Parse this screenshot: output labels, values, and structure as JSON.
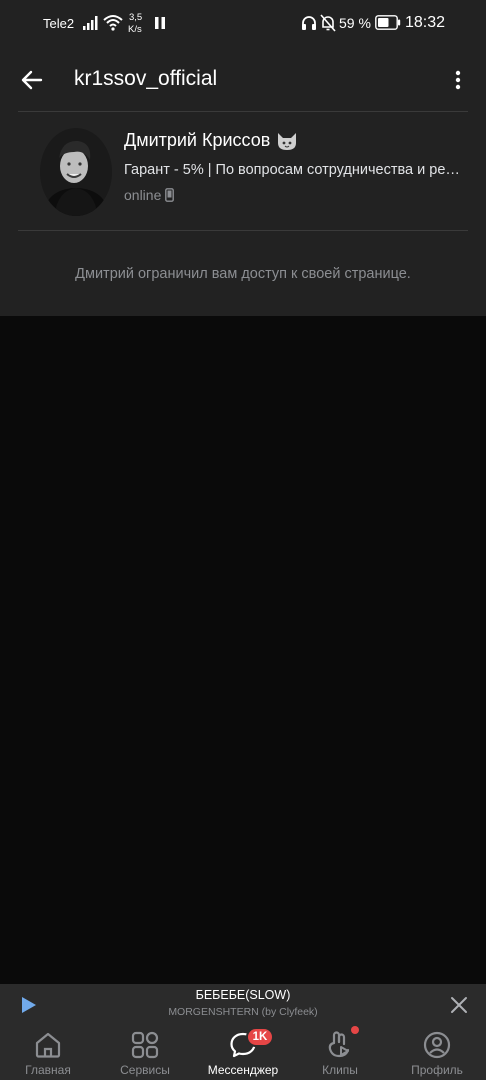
{
  "statusbar": {
    "carrier": "Tele2",
    "speed_value": "3,5",
    "speed_unit": "K/s",
    "battery": "59 %",
    "time": "18:32"
  },
  "header": {
    "title": "kr1ssov_official"
  },
  "profile": {
    "name": "Дмитрий Криссов",
    "status": "Гарант - 5% | По вопросам сотрудничества и ре…",
    "online": "online",
    "restricted_message": "Дмитрий ограничил вам доступ к своей странице."
  },
  "player": {
    "title": "БЕБЕБЕ(SLOW)",
    "artist": "MORGENSHTERN (by Clyfeek)"
  },
  "tabs": [
    {
      "label": "Главная",
      "icon": "home-icon"
    },
    {
      "label": "Сервисы",
      "icon": "services-icon"
    },
    {
      "label": "Мессенджер",
      "icon": "messenger-icon",
      "active": true,
      "badge": "1K"
    },
    {
      "label": "Клипы",
      "icon": "clips-icon",
      "dot": true
    },
    {
      "label": "Профиль",
      "icon": "profile-icon"
    }
  ],
  "colors": {
    "background": "#0a0a0a",
    "surface": "#222222",
    "bar": "#2b2b2b",
    "badge": "#e64646",
    "play": "#71aaeb"
  }
}
